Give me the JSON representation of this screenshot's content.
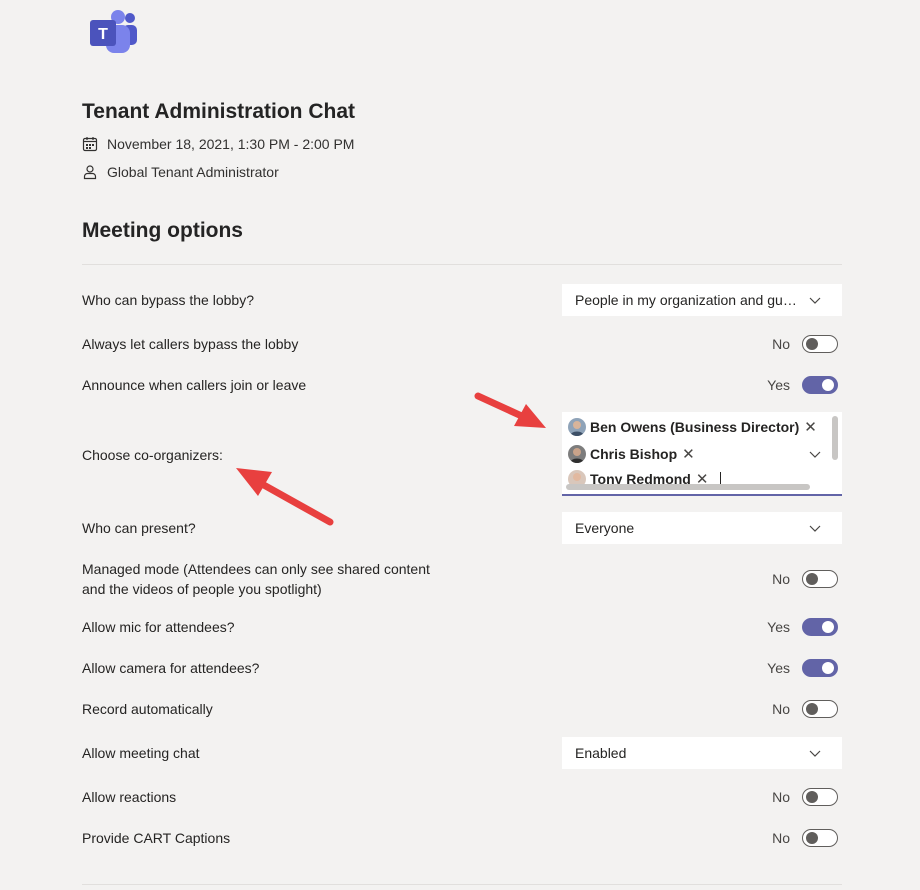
{
  "app": {
    "name": "Microsoft Teams",
    "logo_icon": "teams-logo-icon"
  },
  "meeting": {
    "title": "Tenant Administration Chat",
    "datetime": "November 18, 2021, 1:30 PM - 2:00 PM",
    "organizer": "Global Tenant Administrator",
    "calendar_icon": "calendar-icon",
    "organizer_icon": "person-icon"
  },
  "section_title": "Meeting options",
  "options": {
    "bypass_lobby": {
      "label": "Who can bypass the lobby?",
      "value": "People in my organization and guests"
    },
    "callers_bypass": {
      "label": "Always let callers bypass the lobby",
      "state": "No",
      "on": false
    },
    "announce_callers": {
      "label": "Announce when callers join or leave",
      "state": "Yes",
      "on": true
    },
    "co_organizers": {
      "label": "Choose co-organizers:",
      "people": [
        {
          "name": "Ben Owens (Business Director)"
        },
        {
          "name": "Chris Bishop"
        },
        {
          "name": "Tony Redmond"
        }
      ]
    },
    "who_can_present": {
      "label": "Who can present?",
      "value": "Everyone"
    },
    "managed_mode": {
      "label_line1": "Managed mode (Attendees can only see shared content",
      "label_line2": "and the videos of people you spotlight)",
      "state": "No",
      "on": false
    },
    "allow_mic": {
      "label": "Allow mic for attendees?",
      "state": "Yes",
      "on": true
    },
    "allow_camera": {
      "label": "Allow camera for attendees?",
      "state": "Yes",
      "on": true
    },
    "record_auto": {
      "label": "Record automatically",
      "state": "No",
      "on": false
    },
    "meeting_chat": {
      "label": "Allow meeting chat",
      "value": "Enabled"
    },
    "reactions": {
      "label": "Allow reactions",
      "state": "No",
      "on": false
    },
    "cart_captions": {
      "label": "Provide CART Captions",
      "state": "No",
      "on": false
    }
  },
  "colors": {
    "accent": "#6264a7",
    "background": "#f3f2f1",
    "annotation_arrow": "#e8403f"
  }
}
